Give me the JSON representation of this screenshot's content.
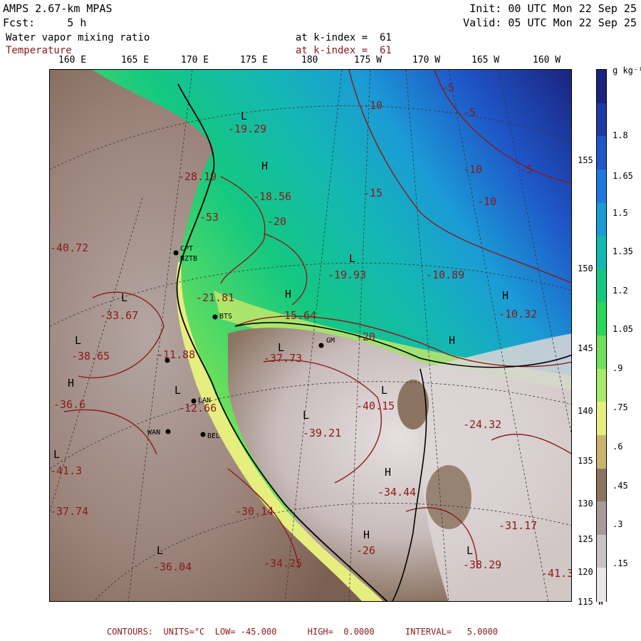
{
  "header": {
    "model": "AMPS 2.67-km MPAS",
    "init": "Init: 00 UTC Mon 22 Sep 25",
    "fcst": "Fcst:     5 h",
    "valid": "Valid: 05 UTC Mon 22 Sep 25",
    "field1": "Water vapor mixing ratio",
    "field1_level": "at k-index =  61",
    "field2": "Temperature",
    "field2_level": "at k-index =  61"
  },
  "lon_labels": [
    "160 E",
    "165 E",
    "170 E",
    "175 E",
    "180",
    "175 W",
    "170 W",
    "165 W",
    "160 W"
  ],
  "lat_labels": [
    "155 W",
    "150 W",
    "145 W",
    "140 W",
    "135 W",
    "130 W",
    "125 W",
    "120 W",
    "115 W"
  ],
  "colorbar": {
    "unit": "g kg⁻¹",
    "labels": [
      "1.8",
      "1.65",
      "1.5",
      "1.35",
      "1.2",
      "1.05",
      ".9",
      ".75",
      ".6",
      ".45",
      ".3",
      ".15"
    ],
    "colors": [
      "#1a237e",
      "#1e3aa8",
      "#1f56c8",
      "#1f78df",
      "#1b9bd6",
      "#14b7b4",
      "#14c880",
      "#2bd65a",
      "#6ee05a",
      "#a8e86a",
      "#e6ee80",
      "#c8b46e",
      "#8c7462",
      "#a89a96",
      "#cbc3c3",
      "#ebe7e7"
    ]
  },
  "stations": [
    "CPT",
    "NZTB",
    "BTS",
    "GM",
    "LAN",
    "WAN",
    "BEL"
  ],
  "map_labels": {
    "temps": [
      "-19.29",
      "-28.19",
      "-18.56",
      "-20",
      "-19.93",
      "-10.89",
      "-10.32",
      "-15.64",
      "-21.81",
      "-33.67",
      "-38.65",
      "-11.88",
      "-36.6",
      "-12.66",
      "-41.3",
      "-37.74",
      "-36.04",
      "-37.73",
      "-40.15",
      "-39.21",
      "-34.44",
      "-24.32",
      "-31.17",
      "-38.29",
      "-26",
      "-34.25",
      "-30.14",
      "-41.3",
      "-40.72",
      "-53",
      "-20",
      "-15",
      "-10",
      "-5",
      "-5",
      "-10",
      "-5",
      "-10"
    ],
    "highs": [
      "H",
      "H",
      "H",
      "H",
      "H",
      "H",
      "H"
    ],
    "lows": [
      "L",
      "L",
      "L",
      "L",
      "L",
      "L",
      "L",
      "L",
      "L",
      "L",
      "L"
    ]
  },
  "footer": "CONTOURS:  UNITS=°C  LOW= -45.000      HIGH=  0.0000      INTERVAL=   5.0000"
}
